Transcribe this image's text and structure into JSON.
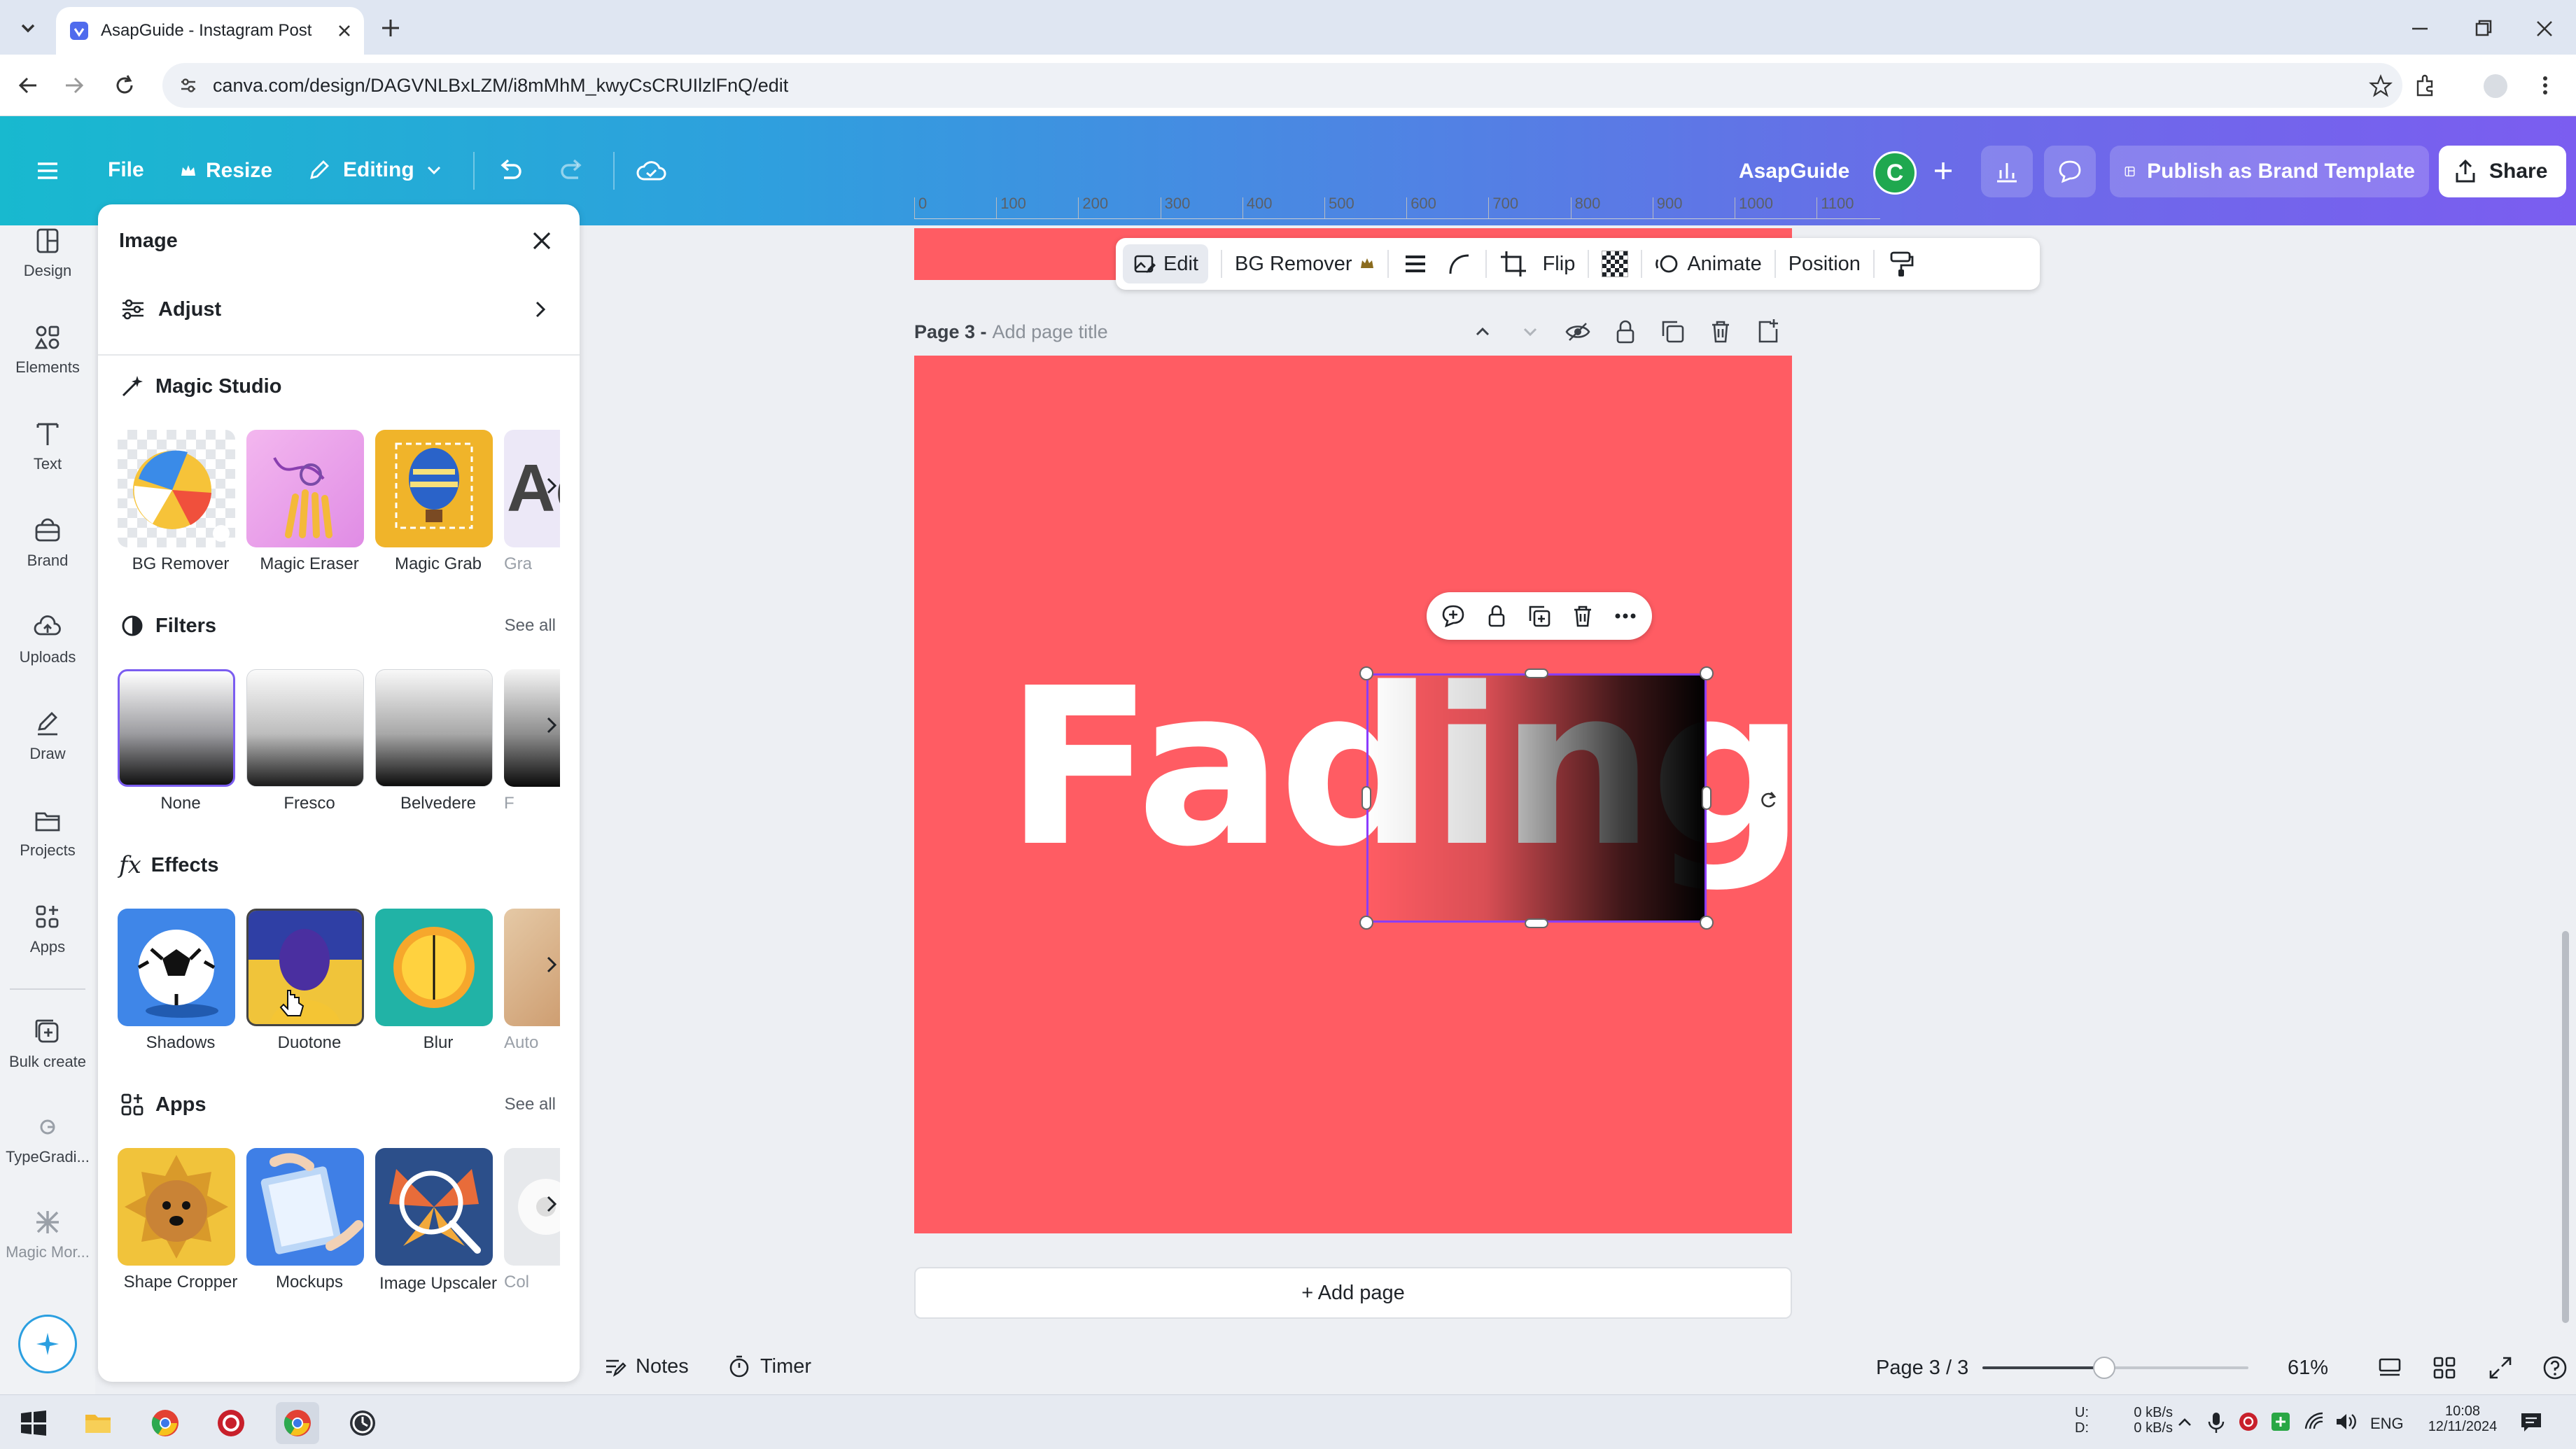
{
  "browser": {
    "tab_title": "AsapGuide - Instagram Post",
    "url": "canva.com/design/DAGVNLBxLZM/i8mMhM_kwyCsCRUIlzlFnQ/edit"
  },
  "header": {
    "file": "File",
    "resize": "Resize",
    "editing": "Editing",
    "team_name": "AsapGuide",
    "avatar_letter": "C",
    "publish": "Publish as Brand Template",
    "share": "Share"
  },
  "rail": {
    "items": [
      {
        "label": "Design",
        "icon": "design-icon"
      },
      {
        "label": "Elements",
        "icon": "elements-icon"
      },
      {
        "label": "Text",
        "icon": "text-icon"
      },
      {
        "label": "Brand",
        "icon": "brand-icon"
      },
      {
        "label": "Uploads",
        "icon": "uploads-icon"
      },
      {
        "label": "Draw",
        "icon": "draw-icon"
      },
      {
        "label": "Projects",
        "icon": "projects-icon"
      },
      {
        "label": "Apps",
        "icon": "apps-icon"
      },
      {
        "label": "Bulk create",
        "icon": "bulk-create-icon"
      },
      {
        "label": "TypeGradi...",
        "icon": "typegradient-icon"
      },
      {
        "label": "Magic Mor...",
        "icon": "magic-morph-icon"
      }
    ]
  },
  "panel": {
    "title": "Image",
    "adjust": "Adjust",
    "magic_studio": {
      "title": "Magic Studio",
      "items": [
        "BG Remover",
        "Magic Eraser",
        "Magic Grab",
        "Gra"
      ]
    },
    "filters": {
      "title": "Filters",
      "see_all": "See all",
      "items": [
        "None",
        "Fresco",
        "Belvedere",
        "F"
      ]
    },
    "effects": {
      "title": "Effects",
      "items": [
        "Shadows",
        "Duotone",
        "Blur",
        "Auto"
      ]
    },
    "apps": {
      "title": "Apps",
      "see_all": "See all",
      "items": [
        "Shape Cropper",
        "Mockups",
        "Image Upscaler",
        "Col"
      ]
    }
  },
  "ruler": {
    "ticks": [
      "0",
      "100",
      "200",
      "300",
      "400",
      "500",
      "600",
      "700",
      "800",
      "900",
      "1000",
      "1100"
    ]
  },
  "context_toolbar": {
    "edit": "Edit",
    "bg_remover": "BG Remover",
    "flip": "Flip",
    "animate": "Animate",
    "position": "Position"
  },
  "page": {
    "label": "Page 3 -",
    "title_placeholder": "Add page title",
    "canvas_text": "Fading",
    "canvas_bg": "#ff5c63"
  },
  "add_page": "+ Add page",
  "statusbar": {
    "notes": "Notes",
    "timer": "Timer",
    "page_indicator": "Page 3 / 3",
    "zoom": "61%",
    "zoom_level": 0.61
  },
  "taskbar": {
    "net_up_label": "U:",
    "net_down_label": "D:",
    "net_up": "0 kB/s",
    "net_down": "0 kB/s",
    "lang": "ENG",
    "time": "10:08",
    "date": "12/11/2024"
  },
  "colors": {
    "accent": "#7b5df0",
    "teal": "#18b9cf",
    "canvas": "#ff5c63"
  }
}
